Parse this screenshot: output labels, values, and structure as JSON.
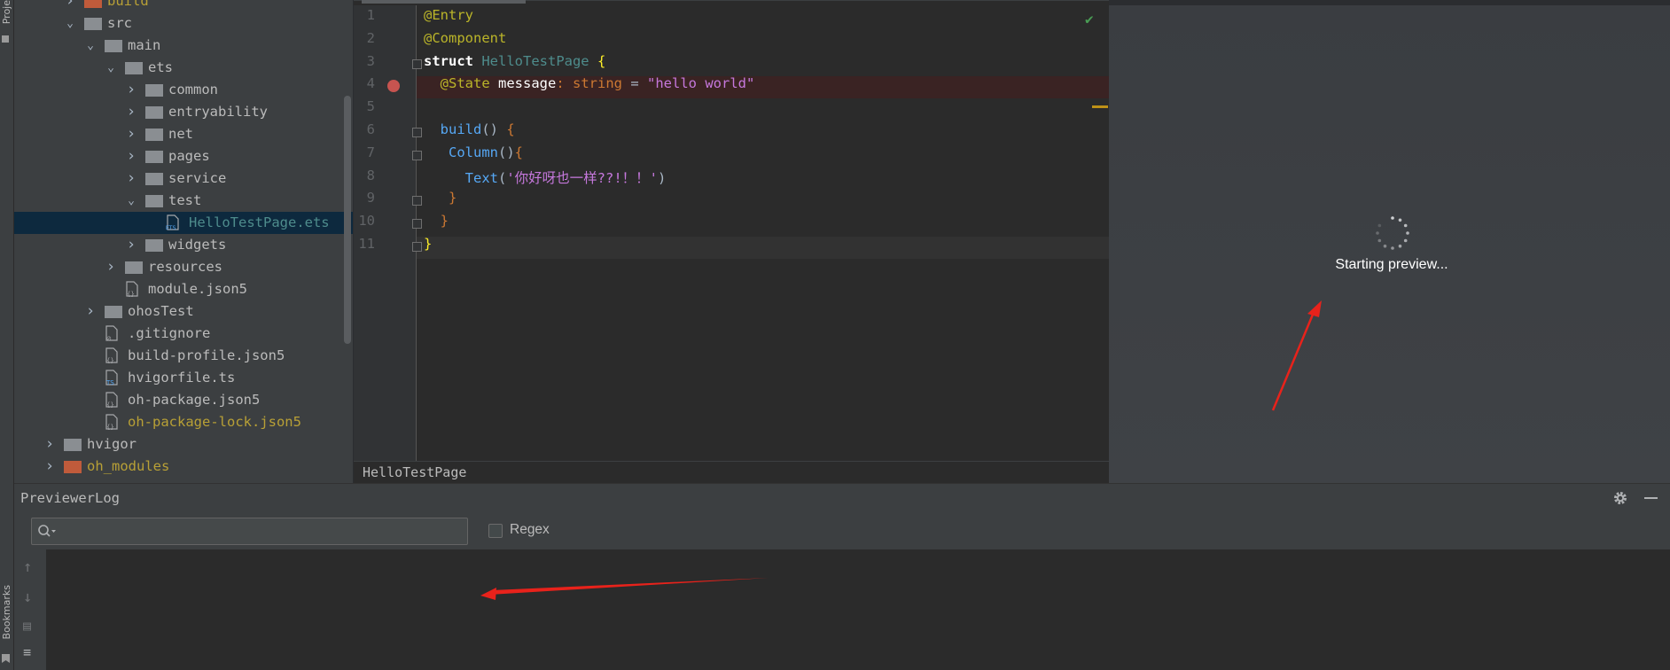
{
  "left_strip": {
    "project_label": "Proje",
    "bookmarks_label": "Bookmarks"
  },
  "tree": {
    "rows": [
      {
        "label": "build",
        "type": "folder",
        "expanded": false,
        "excluded": true
      },
      {
        "label": "src",
        "type": "folder",
        "expanded": true
      },
      {
        "label": "main",
        "type": "folder",
        "expanded": true
      },
      {
        "label": "ets",
        "type": "folder",
        "expanded": true
      },
      {
        "label": "common",
        "type": "folder",
        "expanded": false
      },
      {
        "label": "entryability",
        "type": "folder",
        "expanded": false
      },
      {
        "label": "net",
        "type": "folder",
        "expanded": false
      },
      {
        "label": "pages",
        "type": "folder",
        "expanded": false
      },
      {
        "label": "service",
        "type": "folder",
        "expanded": false
      },
      {
        "label": "test",
        "type": "folder",
        "expanded": true
      },
      {
        "label": "HelloTestPage.ets",
        "type": "ets-file",
        "selected": true
      },
      {
        "label": "widgets",
        "type": "folder",
        "expanded": false
      },
      {
        "label": "resources",
        "type": "folder",
        "expanded": false
      },
      {
        "label": "module.json5",
        "type": "json-file"
      },
      {
        "label": "ohosTest",
        "type": "folder",
        "expanded": false
      },
      {
        "label": ".gitignore",
        "type": "ignore-file"
      },
      {
        "label": "build-profile.json5",
        "type": "json-file"
      },
      {
        "label": "hvigorfile.ts",
        "type": "ts-file"
      },
      {
        "label": "oh-package.json5",
        "type": "json-file"
      },
      {
        "label": "oh-package-lock.json5",
        "type": "json-file",
        "modified": true
      },
      {
        "label": "hvigor",
        "type": "folder",
        "expanded": false
      },
      {
        "label": "oh_modules",
        "type": "folder",
        "expanded": false,
        "excluded": true
      }
    ]
  },
  "editor": {
    "line_numbers": [
      "1",
      "2",
      "3",
      "4",
      "5",
      "6",
      "7",
      "8",
      "9",
      "10",
      "11"
    ],
    "lines": [
      {
        "ln": "1",
        "tokens": [
          {
            "t": "@Entry",
            "c": "#bbb529"
          }
        ]
      },
      {
        "ln": "2",
        "tokens": [
          {
            "t": "@Component",
            "c": "#bbb529"
          }
        ]
      },
      {
        "ln": "3",
        "tokens": [
          {
            "t": "struct ",
            "c": "#ffffff"
          },
          {
            "t": "HelloTestPage ",
            "c": "#4e8c8c"
          },
          {
            "t": "{",
            "c": "#ffef28"
          }
        ]
      },
      {
        "ln": "4",
        "tokens": [
          {
            "t": "  @State ",
            "c": "#bbb529"
          },
          {
            "t": "message",
            "c": "#ffffff"
          },
          {
            "t": ": ",
            "c": "#cc7832"
          },
          {
            "t": "string ",
            "c": "#cc7832"
          },
          {
            "t": "= ",
            "c": "#a9b7c6"
          },
          {
            "t": "\"hello world\"",
            "c": "#c678dd"
          }
        ]
      },
      {
        "ln": "5",
        "tokens": []
      },
      {
        "ln": "6",
        "tokens": [
          {
            "t": "  build",
            "c": "#56a8f5"
          },
          {
            "t": "() ",
            "c": "#a9b7c6"
          },
          {
            "t": "{",
            "c": "#cc7832"
          }
        ]
      },
      {
        "ln": "7",
        "tokens": [
          {
            "t": "   Column",
            "c": "#56a8f5"
          },
          {
            "t": "()",
            "c": "#a9b7c6"
          },
          {
            "t": "{",
            "c": "#cc7832"
          }
        ]
      },
      {
        "ln": "8",
        "tokens": [
          {
            "t": "     Text",
            "c": "#56a8f5"
          },
          {
            "t": "(",
            "c": "#a9b7c6"
          },
          {
            "t": "'你好呀也一样??!！！'",
            "c": "#c678dd"
          },
          {
            "t": ")",
            "c": "#a9b7c6"
          }
        ]
      },
      {
        "ln": "9",
        "tokens": [
          {
            "t": "   }",
            "c": "#cc7832"
          }
        ]
      },
      {
        "ln": "10",
        "tokens": [
          {
            "t": "  }",
            "c": "#cc7832"
          }
        ]
      },
      {
        "ln": "11",
        "tokens": [
          {
            "t": "}",
            "c": "#ffef28"
          }
        ]
      }
    ],
    "breadcrumb": "HelloTestPage",
    "inspection_icon": "check-icon"
  },
  "preview": {
    "status_text": "Starting preview...",
    "icon": "spinner-icon"
  },
  "log_panel": {
    "title": "PreviewerLog",
    "search_placeholder": "",
    "regex_label": "Regex",
    "regex_checked": false,
    "settings_icon": "gear-icon",
    "minimize_icon": "minimize-icon",
    "side_icons": [
      "arrow-up-icon",
      "arrow-down-icon",
      "scroll-to-end-icon",
      "soft-wrap-icon"
    ]
  },
  "colors": {
    "arrow_annotation": "#e8221b",
    "selection": "#0d293e",
    "folder": "#8a8e92",
    "excluded_folder": "#c05b3b"
  }
}
